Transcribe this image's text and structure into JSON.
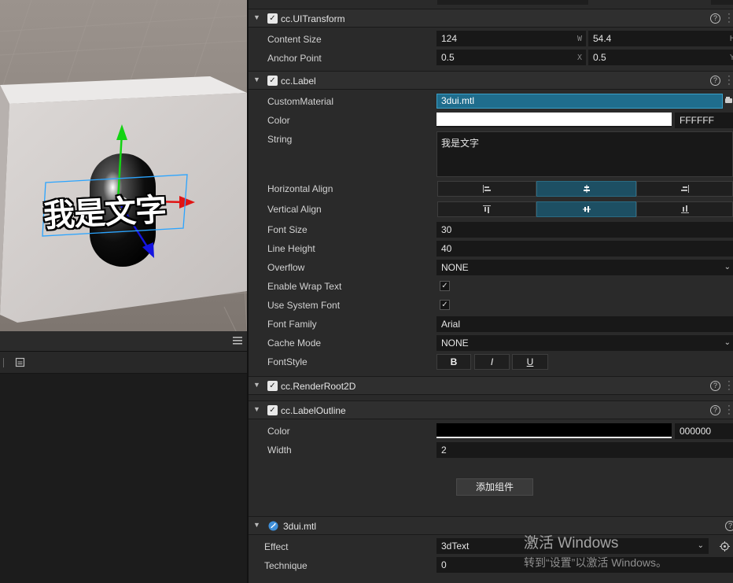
{
  "scene": {
    "label_text": "我是文字"
  },
  "inspector": {
    "ui_transform": {
      "title": "cc.UITransform",
      "content_size_label": "Content Size",
      "width": "124",
      "width_unit": "W",
      "height": "54.4",
      "height_unit": "H",
      "anchor_point_label": "Anchor Point",
      "anchor_x": "0.5",
      "anchor_x_unit": "X",
      "anchor_y": "0.5",
      "anchor_y_unit": "Y"
    },
    "label": {
      "title": "cc.Label",
      "custom_material_label": "CustomMaterial",
      "custom_material": "3dui.mtl",
      "color_label": "Color",
      "color_hex": "FFFFFF",
      "color_value": "#ffffff",
      "string_label": "String",
      "string": "我是文字",
      "horizontal_align_label": "Horizontal Align",
      "vertical_align_label": "Vertical Align",
      "font_size_label": "Font Size",
      "font_size": "30",
      "line_height_label": "Line Height",
      "line_height": "40",
      "overflow_label": "Overflow",
      "overflow": "NONE",
      "wrap_label": "Enable Wrap Text",
      "wrap_checked": true,
      "system_font_label": "Use System Font",
      "system_font_checked": true,
      "font_family_label": "Font Family",
      "font_family": "Arial",
      "cache_mode_label": "Cache Mode",
      "cache_mode": "NONE",
      "font_style_label": "FontStyle",
      "bold": "B",
      "italic": "I",
      "underline": "U"
    },
    "render_root": {
      "title": "cc.RenderRoot2D"
    },
    "label_outline": {
      "title": "cc.LabelOutline",
      "color_label": "Color",
      "color_hex": "000000",
      "color_value": "#000000",
      "width_label": "Width",
      "width": "2"
    },
    "add_component": "添加组件",
    "material": {
      "title": "3dui.mtl",
      "effect_label": "Effect",
      "effect": "3dText",
      "technique_label": "Technique",
      "technique": "0"
    }
  },
  "watermark": {
    "line1": "激活 Windows",
    "line2": "转到“设置”以激活 Windows。"
  },
  "colors": {
    "accent": "#1d4f63",
    "panel": "#2a2a2a",
    "field": "#181818"
  }
}
